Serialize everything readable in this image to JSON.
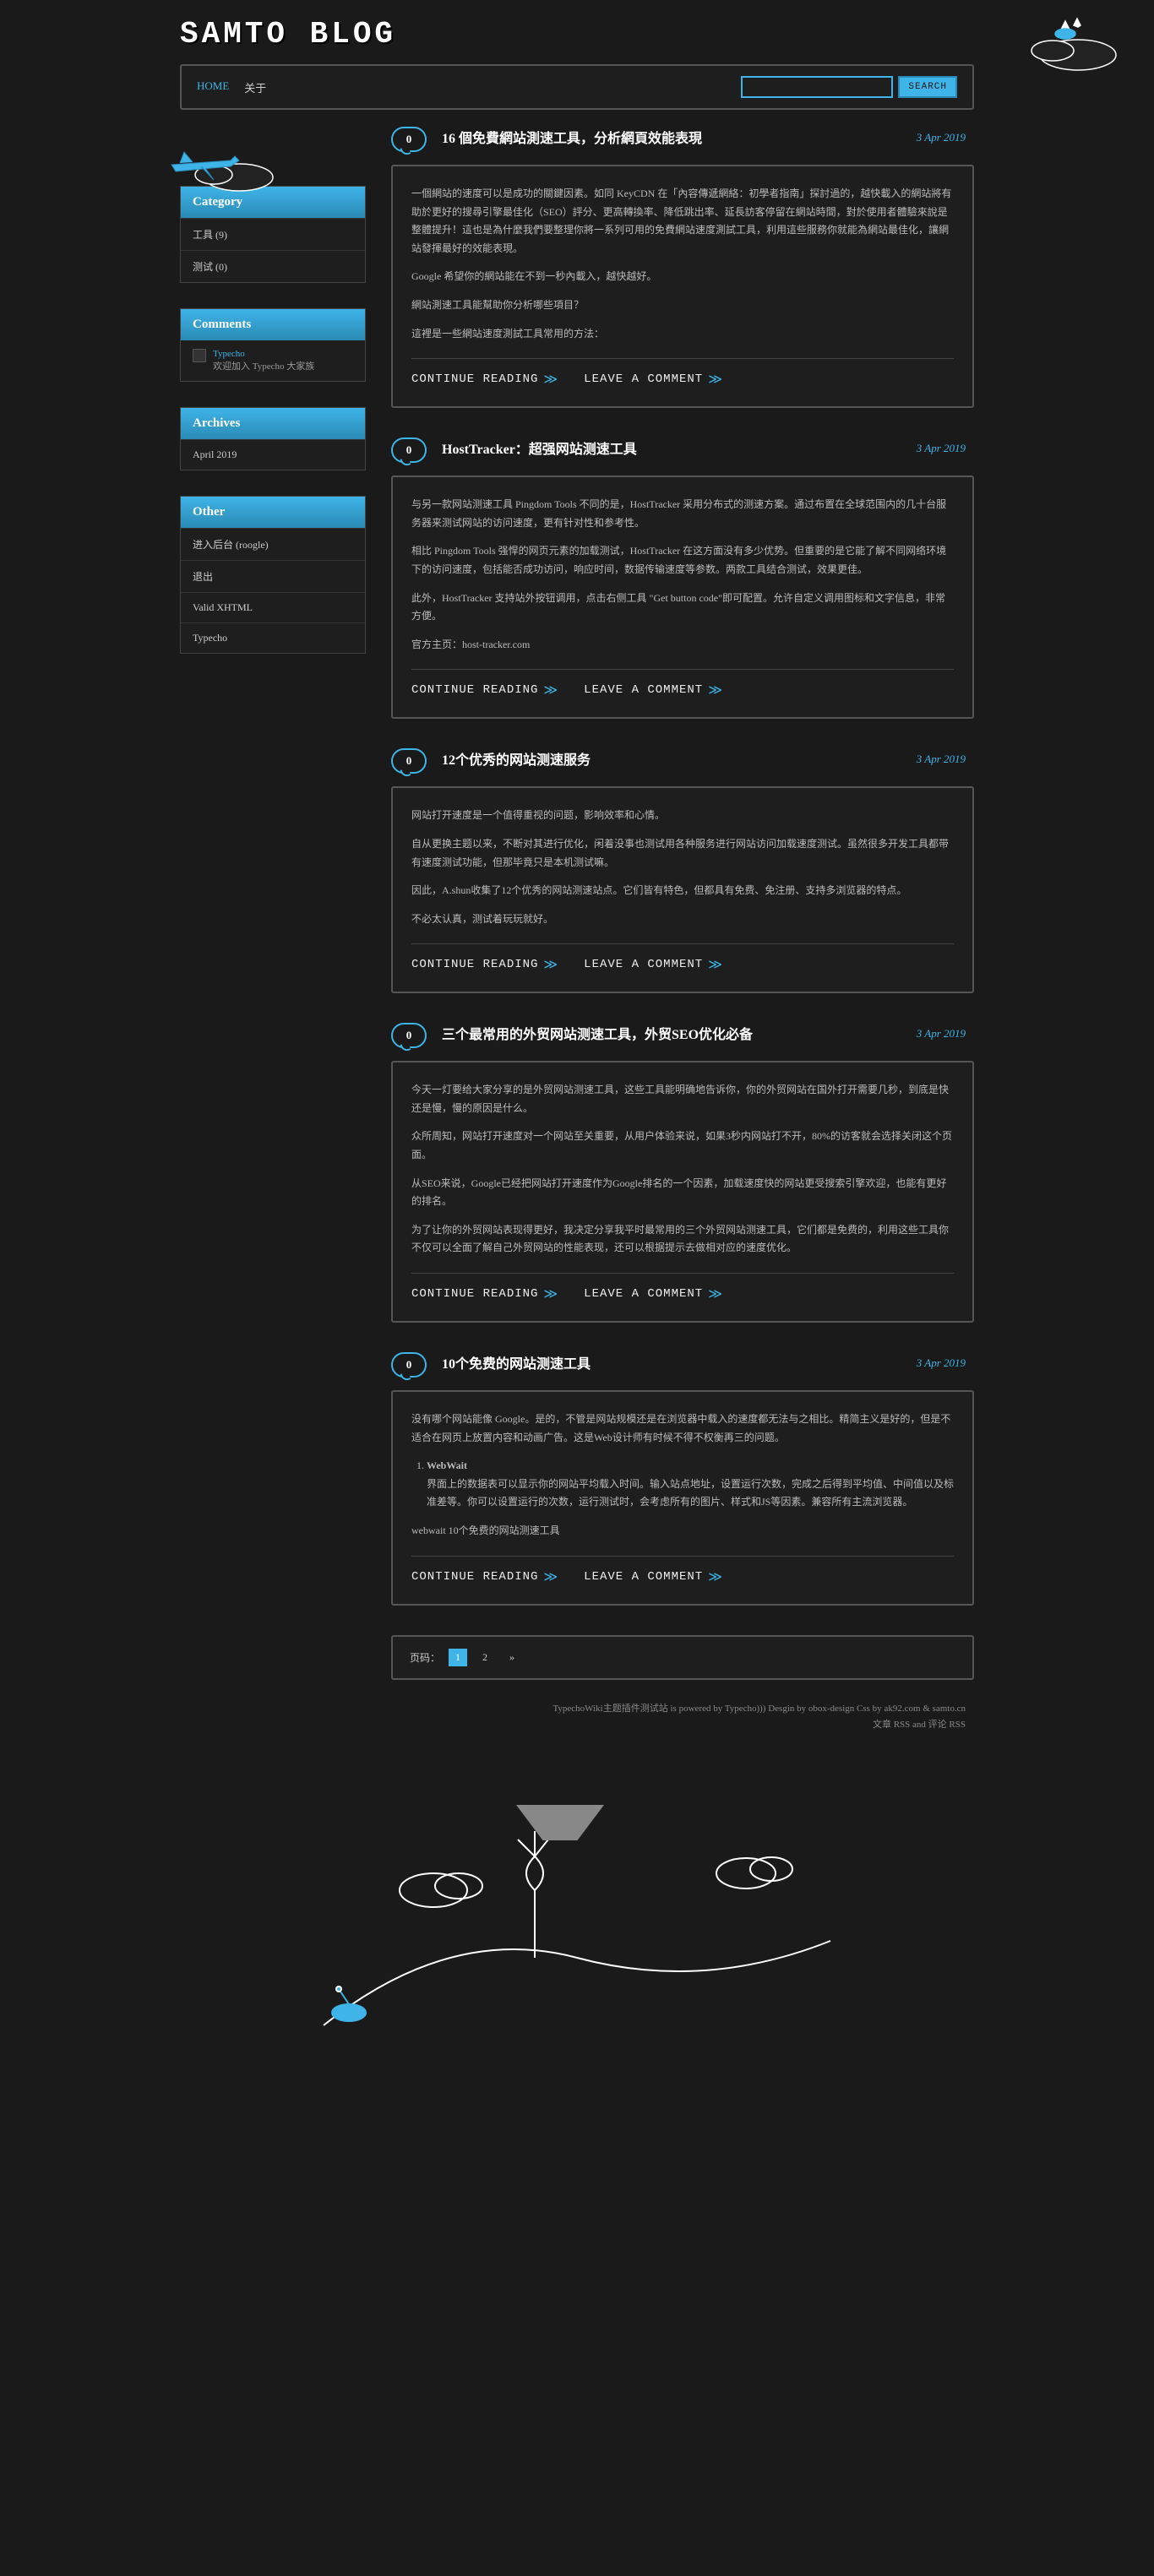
{
  "site": {
    "title": "SAMTO BLOG"
  },
  "nav": {
    "home": "HOME",
    "about": "关于"
  },
  "search": {
    "button": "SEARCH"
  },
  "widgets": {
    "category": {
      "title": "Category",
      "items": [
        "工具 (9)",
        "测试 (0)"
      ]
    },
    "comments": {
      "title": "Comments",
      "item": {
        "name": "Typecho",
        "text": "欢迎加入 Typecho 大家族"
      }
    },
    "archives": {
      "title": "Archives",
      "items": [
        "April 2019"
      ]
    },
    "other": {
      "title": "Other",
      "items": [
        "进入后台 (roogle)",
        "退出",
        "Valid XHTML",
        "Typecho"
      ]
    }
  },
  "posts": [
    {
      "comments": "0",
      "title": "16 個免費網站測速工具，分析網頁效能表現",
      "date": "3 Apr 2019",
      "body": [
        "一個網站的速度可以是成功的關鍵因素。如同 KeyCDN 在「內容傳遞網絡：初學者指南」探討過的，越快載入的網站將有助於更好的搜尋引擎最佳化（SEO）評分、更高轉換率、降低跳出率、延長訪客停留在網站時間，對於使用者體驗來說是整體提升！這也是為什麼我們要整理你將一系列可用的免費網站速度測試工具，利用這些服務你就能為網站最佳化，讓網站發揮最好的效能表現。",
        "Google 希望你的網站能在不到一秒內載入，越快越好。",
        "網站測速工具能幫助你分析哪些項目？",
        "這裡是一些網站速度測試工具常用的方法："
      ]
    },
    {
      "comments": "0",
      "title": "HostTracker：超强网站测速工具",
      "date": "3 Apr 2019",
      "body": [
        "与另一款网站测速工具 Pingdom Tools 不同的是，HostTracker 采用分布式的测速方案。通过布置在全球范围内的几十台服务器来测试网站的访问速度，更有针对性和参考性。",
        "相比 Pingdom Tools 强悍的网页元素的加载测试，HostTracker 在这方面没有多少优势。但重要的是它能了解不同网络环境下的访问速度，包括能否成功访问，响应时间，数据传输速度等参数。两款工具结合测试，效果更佳。",
        "此外，HostTracker 支持站外按钮调用，点击右侧工具 \"Get button code\"即可配置。允许自定义调用图标和文字信息，非常方便。",
        "官方主页：host-tracker.com"
      ]
    },
    {
      "comments": "0",
      "title": "12个优秀的网站测速服务",
      "date": "3 Apr 2019",
      "body": [
        "网站打开速度是一个值得重视的问题，影响效率和心情。",
        "自从更换主题以来，不断对其进行优化，闲着没事也测试用各种服务进行网站访问加载速度测试。虽然很多开发工具都带有速度测试功能，但那毕竟只是本机测试嘛。",
        "因此，A.shun收集了12个优秀的网站测速站点。它们皆有特色，但都具有免费、免注册、支持多浏览器的特点。",
        "不必太认真，测试着玩玩就好。"
      ]
    },
    {
      "comments": "0",
      "title": "三个最常用的外贸网站测速工具，外贸SEO优化必备",
      "date": "3 Apr 2019",
      "body": [
        "今天一灯要给大家分享的是外贸网站测速工具，这些工具能明确地告诉你，你的外贸网站在国外打开需要几秒，到底是快还是慢，慢的原因是什么。",
        "众所周知，网站打开速度对一个网站至关重要，从用户体验来说，如果3秒内网站打不开，80%的访客就会选择关闭这个页面。",
        "从SEO来说，Google已经把网站打开速度作为Google排名的一个因素，加载速度快的网站更受搜索引擎欢迎，也能有更好的排名。",
        "为了让你的外贸网站表现得更好，我决定分享我平时最常用的三个外贸网站测速工具，它们都是免费的，利用这些工具你不仅可以全面了解自己外贸网站的性能表现，还可以根据提示去做相对应的速度优化。"
      ]
    },
    {
      "comments": "0",
      "title": "10个免费的网站测速工具",
      "date": "3 Apr 2019",
      "body": [
        "没有哪个网站能像 Google。是的，不管是网站规模还是在浏览器中载入的速度都无法与之相比。精简主义是好的，但是不适合在网页上放置内容和动画广告。这是Web设计师有时候不得不权衡再三的问题。"
      ],
      "list_title": "WebWait",
      "list_body": "界面上的数据表可以显示你的网站平均载入时间。输入站点地址，设置运行次数，完成之后得到平均值、中间值以及标准差等。你可以设置运行的次数，运行测试时，会考虑所有的图片、样式和JS等因素。兼容所有主流浏览器。",
      "body2": [
        "webwait 10个免费的网站测速工具"
      ]
    }
  ],
  "pagination": {
    "label": "页码：",
    "pages": [
      "1",
      "2"
    ],
    "next": "»"
  },
  "actions": {
    "continue": "CONTINUE READING",
    "comment": "LEAVE A COMMENT"
  },
  "footer": {
    "line1_pre": "TypechoWiki主题插件测试站",
    "line1_mid": " is powered by Typecho))) Desgin by ",
    "line1_a": "obox-design",
    "line1_mid2": " Css by ",
    "line1_b": "ak92.com",
    "line1_mid3": " & ",
    "line1_c": "samto.cn",
    "line2_a": "文章 RSS",
    "line2_mid": " and ",
    "line2_b": "评论 RSS"
  }
}
